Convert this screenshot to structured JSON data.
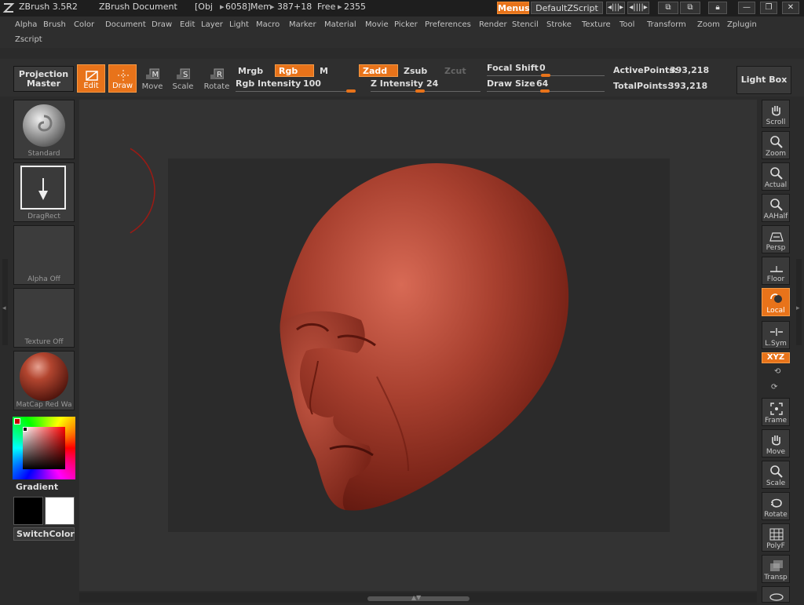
{
  "titlebar": {
    "app": "ZBrush 3.5R2",
    "document": "ZBrush Document",
    "obj": "[Obj",
    "obj_count": "6058]",
    "mem_label": "Mem",
    "mem_value": "387+18",
    "free_label": "Free",
    "free_value": "2355",
    "menus_btn": "Menus",
    "zscript_btn": "DefaultZScript"
  },
  "menubar": {
    "row1": [
      "Alpha",
      "Brush",
      "Color",
      "Document",
      "Draw",
      "Edit",
      "Layer",
      "Light",
      "Macro",
      "Marker",
      "Material",
      "Movie",
      "Picker",
      "Preferences",
      "Render",
      "Stencil",
      "Stroke",
      "Texture",
      "Tool",
      "Transform",
      "Zoom",
      "Zplugin"
    ],
    "row2": [
      "Zscript"
    ]
  },
  "toolbar": {
    "projection_master": [
      "Projection",
      "Master"
    ],
    "edit": "Edit",
    "draw": "Draw",
    "move": "Move",
    "scale": "Scale",
    "rotate": "Rotate",
    "mrgb": "Mrgb",
    "rgb": "Rgb",
    "m": "M",
    "zadd": "Zadd",
    "zsub": "Zsub",
    "zcut": "Zcut",
    "rgb_intensity_label": "Rgb Intensity",
    "rgb_intensity": 100,
    "z_intensity_label": "Z Intensity",
    "z_intensity": 24,
    "focal_shift_label": "Focal Shift",
    "focal_shift": 0,
    "draw_size_label": "Draw Size",
    "draw_size": 64,
    "active_points_label": "ActivePoints:",
    "active_points": "393,218",
    "total_points_label": "TotalPoints:",
    "total_points": "393,218",
    "light_box": "Light Box"
  },
  "leftshelf": {
    "brush": "Standard",
    "stroke": "DragRect",
    "alpha": "Alpha  Off",
    "texture": "Texture  Off",
    "material": "MatCap  Red  Wa",
    "gradient": "Gradient",
    "switch_color": "SwitchColor",
    "primary_color": "#000000",
    "secondary_color": "#ffffff"
  },
  "rightshelf": {
    "scroll": "Scroll",
    "zoom": "Zoom",
    "actual": "Actual",
    "aahalf": "AAHalf",
    "persp": "Persp",
    "floor": "Floor",
    "local": "Local",
    "lsym": "L.Sym",
    "xyz": "XYZ",
    "frame": "Frame",
    "move": "Move",
    "scale": "Scale",
    "rotate": "Rotate",
    "polyf": "PolyF",
    "transp": "Transp"
  },
  "colors": {
    "accent": "#e8731a",
    "model": "#a8402f"
  }
}
